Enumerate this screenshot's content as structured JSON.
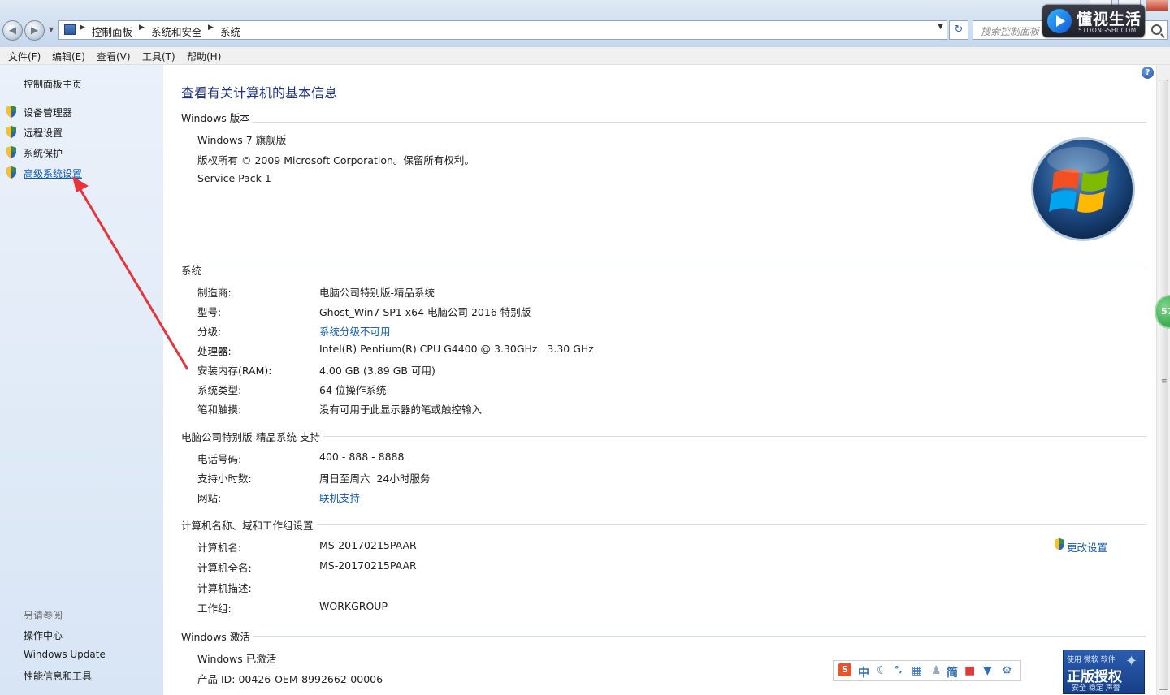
{
  "address_bar": {
    "breadcrumbs": [
      "控制面板",
      "系统和安全",
      "系统"
    ],
    "search_placeholder": "搜索控制面板"
  },
  "watermark": {
    "title": "懂视生活",
    "subtitle": "51DONGSHI.COM"
  },
  "menu": [
    "文件(F)",
    "编辑(E)",
    "查看(V)",
    "工具(T)",
    "帮助(H)"
  ],
  "left_pane": {
    "home": "控制面板主页",
    "tasks": [
      "设备管理器",
      "远程设置",
      "系统保护",
      "高级系统设置"
    ],
    "see_also_title": "另请参阅",
    "see_also": [
      "操作中心",
      "Windows Update",
      "性能信息和工具"
    ]
  },
  "main": {
    "title": "查看有关计算机的基本信息",
    "windows_edition": {
      "heading": "Windows 版本",
      "lines": [
        "Windows 7 旗舰版",
        "版权所有 © 2009 Microsoft Corporation。保留所有权利。",
        "Service Pack 1"
      ]
    },
    "system": {
      "heading": "系统",
      "rows": [
        {
          "label": "制造商:",
          "value": "电脑公司特别版-精品系统"
        },
        {
          "label": "型号:",
          "value": "Ghost_Win7 SP1 x64 电脑公司 2016 特别版"
        },
        {
          "label": "分级:",
          "value": "系统分级不可用"
        },
        {
          "label": "处理器:",
          "value": "Intel(R) Pentium(R) CPU G4400 @ 3.30GHz   3.30 GHz"
        },
        {
          "label": "安装内存(RAM):",
          "value": "4.00 GB (3.89 GB 可用)"
        },
        {
          "label": "系统类型:",
          "value": "64 位操作系统"
        },
        {
          "label": "笔和触摸:",
          "value": "没有可用于此显示器的笔或触控输入"
        }
      ]
    },
    "support": {
      "heading": "电脑公司特别版-精品系统 支持",
      "rows": [
        {
          "label": "电话号码:",
          "value": "400 - 888 - 8888"
        },
        {
          "label": "支持小时数:",
          "value": "周日至周六  24小时服务"
        },
        {
          "label": "网站:",
          "value": "联机支持"
        }
      ]
    },
    "computer_name": {
      "heading": "计算机名称、域和工作组设置",
      "change_settings": "更改设置",
      "rows": [
        {
          "label": "计算机名:",
          "value": "MS-20170215PAAR"
        },
        {
          "label": "计算机全名:",
          "value": "MS-20170215PAAR"
        },
        {
          "label": "计算机描述:",
          "value": ""
        },
        {
          "label": "工作组:",
          "value": "WORKGROUP"
        }
      ]
    },
    "activation": {
      "heading": "Windows 激活",
      "status": "Windows 已激活",
      "product_id": "产品 ID: 00426-OEM-8992662-00006"
    }
  },
  "ime_bar": {
    "mode": "中",
    "simplified": "简"
  },
  "genuine_badge": {
    "top": "使用 微软 软件",
    "main": "正版授权",
    "bottom": "安全 稳定 声誉"
  },
  "side_badge": "57",
  "colors": {
    "link": "#0f5ab5",
    "title": "#1e3287",
    "annotation_arrow": "#e8333a"
  }
}
